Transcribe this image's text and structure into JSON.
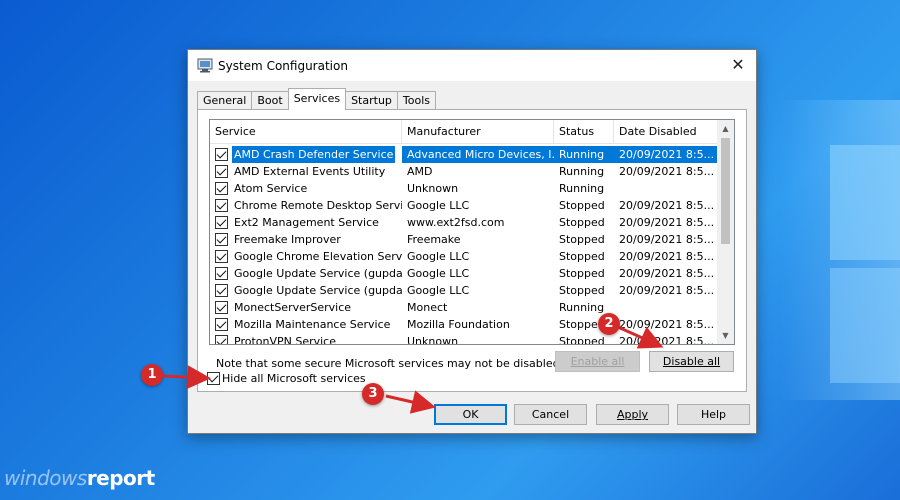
{
  "window": {
    "title": "System Configuration",
    "close_glyph": "✕"
  },
  "tabs": [
    {
      "label": "General",
      "active": false
    },
    {
      "label": "Boot",
      "active": false
    },
    {
      "label": "Services",
      "active": true
    },
    {
      "label": "Startup",
      "active": false
    },
    {
      "label": "Tools",
      "active": false
    }
  ],
  "services": {
    "columns": [
      "Service",
      "Manufacturer",
      "Status",
      "Date Disabled"
    ],
    "rows": [
      {
        "checked": true,
        "service": "AMD Crash Defender Service",
        "manufacturer": "Advanced Micro Devices, I...",
        "status": "Running",
        "date": "20/09/2021 8:5...",
        "selected": true
      },
      {
        "checked": true,
        "service": "AMD External Events Utility",
        "manufacturer": "AMD",
        "status": "Running",
        "date": "20/09/2021 8:5..."
      },
      {
        "checked": true,
        "service": "Atom Service",
        "manufacturer": "Unknown",
        "status": "Running",
        "date": ""
      },
      {
        "checked": true,
        "service": "Chrome Remote Desktop Service",
        "manufacturer": "Google LLC",
        "status": "Stopped",
        "date": "20/09/2021 8:5..."
      },
      {
        "checked": true,
        "service": "Ext2 Management Service",
        "manufacturer": "www.ext2fsd.com",
        "status": "Stopped",
        "date": "20/09/2021 8:5..."
      },
      {
        "checked": true,
        "service": "Freemake Improver",
        "manufacturer": "Freemake",
        "status": "Stopped",
        "date": "20/09/2021 8:5..."
      },
      {
        "checked": true,
        "service": "Google Chrome Elevation Servic...",
        "manufacturer": "Google LLC",
        "status": "Stopped",
        "date": "20/09/2021 8:5..."
      },
      {
        "checked": true,
        "service": "Google Update Service (gupdate)",
        "manufacturer": "Google LLC",
        "status": "Stopped",
        "date": "20/09/2021 8:5..."
      },
      {
        "checked": true,
        "service": "Google Update Service (gupdatem)",
        "manufacturer": "Google LLC",
        "status": "Stopped",
        "date": "20/09/2021 8:5..."
      },
      {
        "checked": true,
        "service": "MonectServerService",
        "manufacturer": "Monect",
        "status": "Running",
        "date": ""
      },
      {
        "checked": true,
        "service": "Mozilla Maintenance Service",
        "manufacturer": "Mozilla Foundation",
        "status": "Stopped",
        "date": "20/09/2021 8:5..."
      },
      {
        "checked": true,
        "service": "ProtonVPN Service",
        "manufacturer": "Unknown",
        "status": "Stopped",
        "date": "20/09/2021 8:5..."
      }
    ]
  },
  "note": "Note that some secure Microsoft services may not be disabled.",
  "buttons": {
    "enable_all": "Enable all",
    "disable_all": "Disable all",
    "ok": "OK",
    "cancel": "Cancel",
    "apply": "Apply",
    "help": "Help"
  },
  "hide_ms": {
    "label": "Hide all Microsoft services",
    "checked": true
  },
  "annotations": {
    "badge1": "1",
    "badge2": "2",
    "badge3": "3",
    "color": "#d62a2a"
  },
  "watermark": {
    "part1": "windows",
    "part2": "report"
  },
  "colors": {
    "selection": "#0078d7",
    "desktop": "#1e7fe0"
  }
}
